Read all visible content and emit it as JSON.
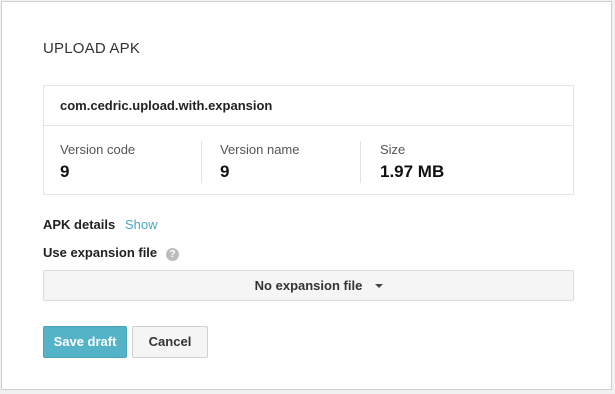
{
  "dialog": {
    "title": "UPLOAD APK"
  },
  "package": {
    "name": "com.cedric.upload.with.expansion",
    "stats": [
      {
        "label": "Version code",
        "value": "9"
      },
      {
        "label": "Version name",
        "value": "9"
      },
      {
        "label": "Size",
        "value": "1.97 MB"
      }
    ]
  },
  "apk_details": {
    "label": "APK details",
    "link": "Show"
  },
  "expansion": {
    "label": "Use expansion file",
    "help_icon": "question-mark",
    "help_glyph": "?",
    "selected": "No expansion file"
  },
  "buttons": {
    "save": "Save draft",
    "cancel": "Cancel"
  },
  "colors": {
    "accent": "#55b3c8",
    "link": "#4aa7c5"
  }
}
